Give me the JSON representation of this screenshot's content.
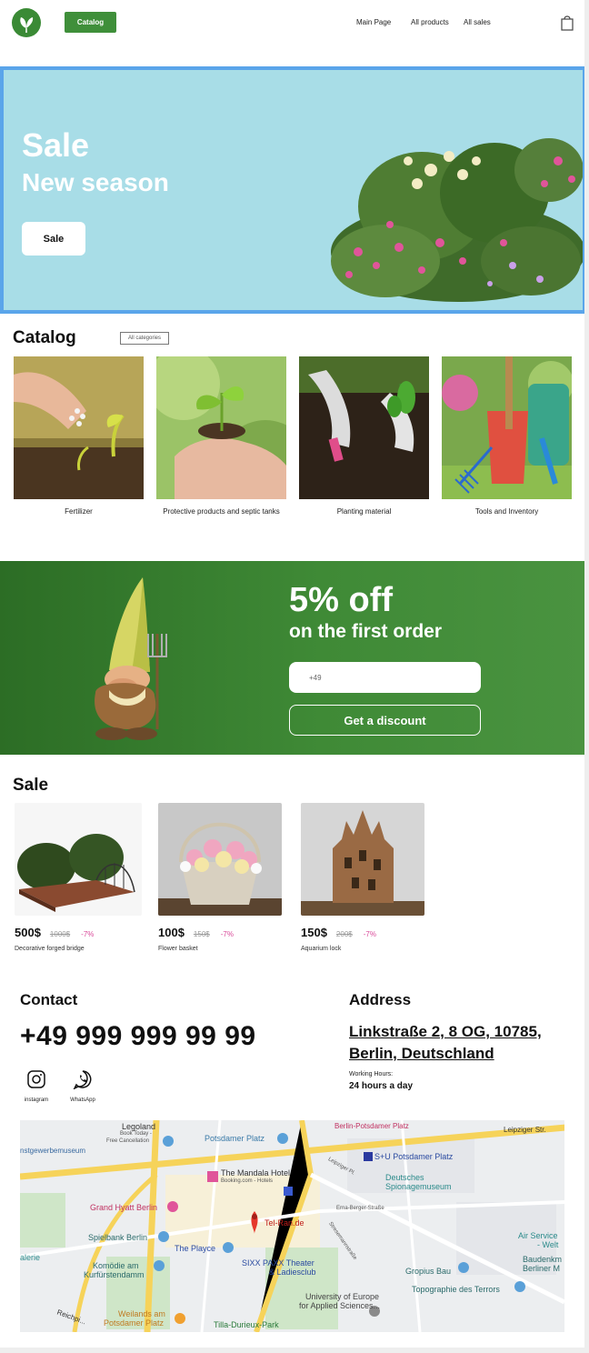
{
  "header": {
    "catalog_button": "Catalog",
    "nav": [
      "Main Page",
      "All products",
      "All sales"
    ]
  },
  "banner": {
    "title": "Sale",
    "subtitle": "New season",
    "button": "Sale"
  },
  "catalog": {
    "title": "Catalog",
    "all_categories": "All categories",
    "items": [
      {
        "label": "Fertilizer"
      },
      {
        "label": "Protective products and septic tanks"
      },
      {
        "label": "Planting material"
      },
      {
        "label": "Tools and Inventory"
      }
    ]
  },
  "promo": {
    "title": "5% off",
    "subtitle": "on the first order",
    "phone_placeholder": "+49",
    "button": "Get a discount"
  },
  "sale": {
    "title": "Sale",
    "products": [
      {
        "price": "500$",
        "old_price": "1000$",
        "discount": "-7%",
        "name": "Decorative forged bridge"
      },
      {
        "price": "100$",
        "old_price": "150$",
        "discount": "-7%",
        "name": "Flower basket"
      },
      {
        "price": "150$",
        "old_price": "200$",
        "discount": "-7%",
        "name": "Aquarium lock"
      }
    ]
  },
  "contact": {
    "title": "Contact",
    "phone": "+49 999 999 99 99",
    "social": [
      {
        "label": "instagram",
        "icon": "instagram-icon"
      },
      {
        "label": "WhatsApp",
        "icon": "whatsapp-icon"
      }
    ]
  },
  "address": {
    "title": "Address",
    "line1": "Linkstraße 2, 8 OG, 10785,",
    "line2": "Berlin, Deutschland",
    "hours_label": "Working Hours:",
    "hours_value": "24 hours a day"
  },
  "map": {
    "labels": {
      "legoland": "Legoland",
      "legoland_sub1": "Book Today -",
      "legoland_sub2": "Free Cancellation",
      "kunst": "nstgewerbemuseum",
      "potsdamer": "Potsdamer Platz",
      "berlin_potsdamer": "Berlin-Potsdamer Platz",
      "leipziger": "Leipziger Str.",
      "leipziger_pl": "Leipziger Pl.",
      "su_potsdamer": "S+U Potsdamer Platz",
      "mandala": "The Mandala Hotel",
      "mandala_sub": "Booking.com - Hotels",
      "spy1": "Deutsches",
      "spy2": "Spionagemuseum",
      "grand_hyatt": "Grand Hyatt Berlin",
      "erna": "Erna-Berger-Straße",
      "telran": "Tel-Ran.de",
      "spielbank": "Spielbank Berlin",
      "stresemann": "Stresemannstraße",
      "playce": "The Playce",
      "airservice1": "Air Service",
      "airservice2": "- Welt",
      "alerie": "alerie",
      "komoedie1": "Komödie am",
      "komoedie2": "Kurfürstendamm",
      "sixx1": "SIXX PAXX Theater",
      "sixx2": "& Ladiesclub",
      "gropius": "Gropius Bau",
      "baudenk1": "Baudenkm",
      "baudenk2": "Berliner M",
      "topographie": "Topographie des Terrors",
      "uni1": "University of Europe",
      "uni2": "for Applied Sciences...",
      "weilands1": "Weilands am",
      "weilands2": "Potsdamer Platz",
      "reichpietsch": "Reichpi...",
      "tilla": "Tilla-Durieux-Park"
    }
  }
}
